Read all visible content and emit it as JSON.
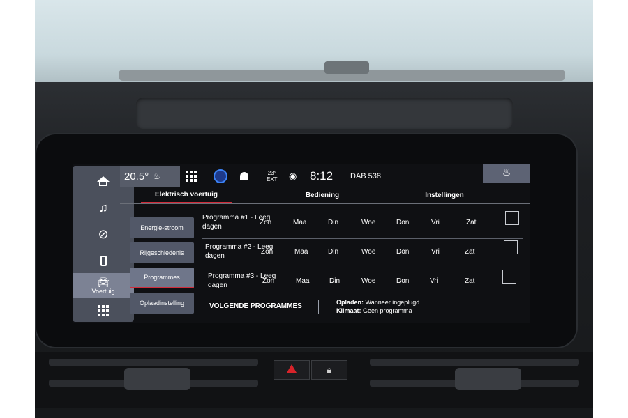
{
  "status": {
    "cabin_temp": "20.5°",
    "ext_temp_value": "23°",
    "ext_temp_label": "EXT",
    "clock": "8:12",
    "radio": "DAB 538"
  },
  "side_nav": {
    "vehicle_label": "Voertuig"
  },
  "tabs": [
    "Elektrisch voertuig",
    "Bediening",
    "Instellingen"
  ],
  "subnav": [
    "Energie-stroom",
    "Rijgeschiedenis",
    "Programmes",
    "Oplaadinstelling"
  ],
  "programs": [
    {
      "name_line1": "Programma #1 - Leeg",
      "name_line2": "dagen",
      "days": [
        "Zon",
        "Maa",
        "Din",
        "Woe",
        "Don",
        "Vri",
        "Zat"
      ]
    },
    {
      "name_line1": "Programma #2 - Leeg",
      "name_line2": "dagen",
      "days": [
        "Zon",
        "Maa",
        "Din",
        "Woe",
        "Don",
        "Vri",
        "Zat"
      ]
    },
    {
      "name_line1": "Programma #3 - Leeg",
      "name_line2": "dagen",
      "days": [
        "Zon",
        "Maa",
        "Din",
        "Woe",
        "Don",
        "Vri",
        "Zat"
      ]
    }
  ],
  "footer": {
    "title": "VOLGENDE PROGRAMMES",
    "charge_label": "Opladen:",
    "charge_value": "Wanneer ingeplugd",
    "climate_label": "Klimaat:",
    "climate_value": "Geen programma"
  },
  "colors": {
    "accent": "#d12b3a",
    "panel": "#525868",
    "screen_bg": "#0f1013"
  },
  "icons": [
    "home-icon",
    "music-icon",
    "navigation-icon",
    "phone-icon",
    "car-icon",
    "apps-grid-icon",
    "seat-heat-icon",
    "profile-icon",
    "bell-icon",
    "location-icon",
    "hazard-icon",
    "lock-icon"
  ]
}
